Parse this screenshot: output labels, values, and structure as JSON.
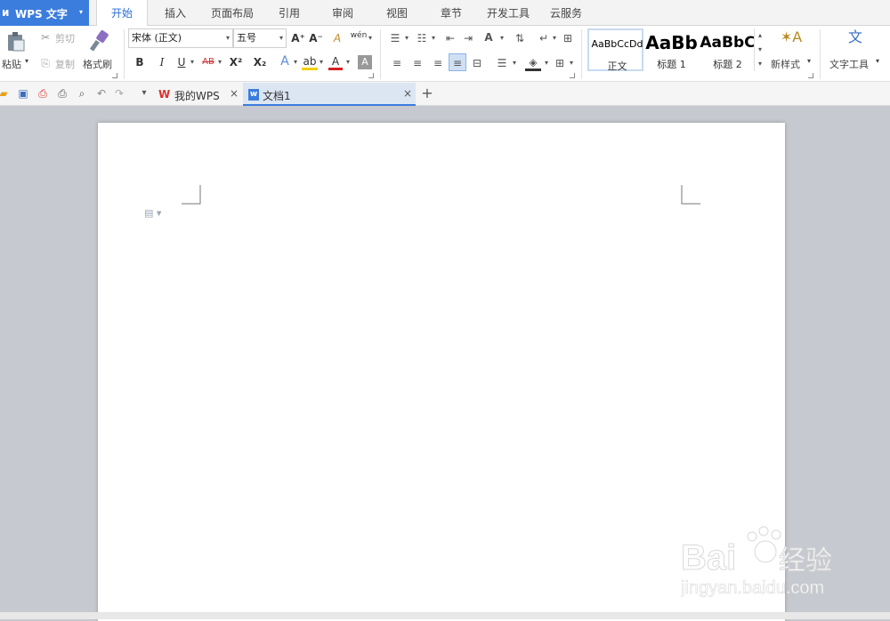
{
  "app": {
    "logo": "ᴎ",
    "name": "WPS 文字",
    "dropdown": "▾"
  },
  "menu_tabs": [
    "开始",
    "插入",
    "页面布局",
    "引用",
    "审阅",
    "视图",
    "章节",
    "开发工具",
    "云服务"
  ],
  "ribbon": {
    "clipboard": {
      "paste": "粘贴",
      "cut": "剪切",
      "copy": "复制",
      "format_painter": "格式刷"
    },
    "font": {
      "name": "宋体 (正文)",
      "size": "五号",
      "bold": "B",
      "italic": "I",
      "underline": "U",
      "strikethrough": "AB",
      "superscript": "X²",
      "subscript": "X₂",
      "font_color": "A",
      "grow": "A⁺",
      "shrink": "A⁻",
      "clear": "A",
      "pinyin": "wén",
      "text_effect": "A",
      "highlight": "ab",
      "char_shading": "A"
    },
    "styles": [
      {
        "sample": "AaBbCcDd",
        "name": "正文"
      },
      {
        "sample": "AaBb",
        "name": "标题 1"
      },
      {
        "sample": "AaBbC",
        "name": "标题 2"
      }
    ],
    "new_style": "新样式",
    "text_tools": "文字工具"
  },
  "quick_access": {
    "menu_arrow": "▾"
  },
  "doc_tabs": [
    {
      "label": "我的WPS",
      "close": "×",
      "icon": "W"
    },
    {
      "label": "文档1",
      "close": "×",
      "icon": "w"
    }
  ],
  "new_tab": "+",
  "colors": {
    "accent": "#3b7ddd",
    "wps_red": "#d9322c",
    "page_bg": "#c6c9cf"
  }
}
